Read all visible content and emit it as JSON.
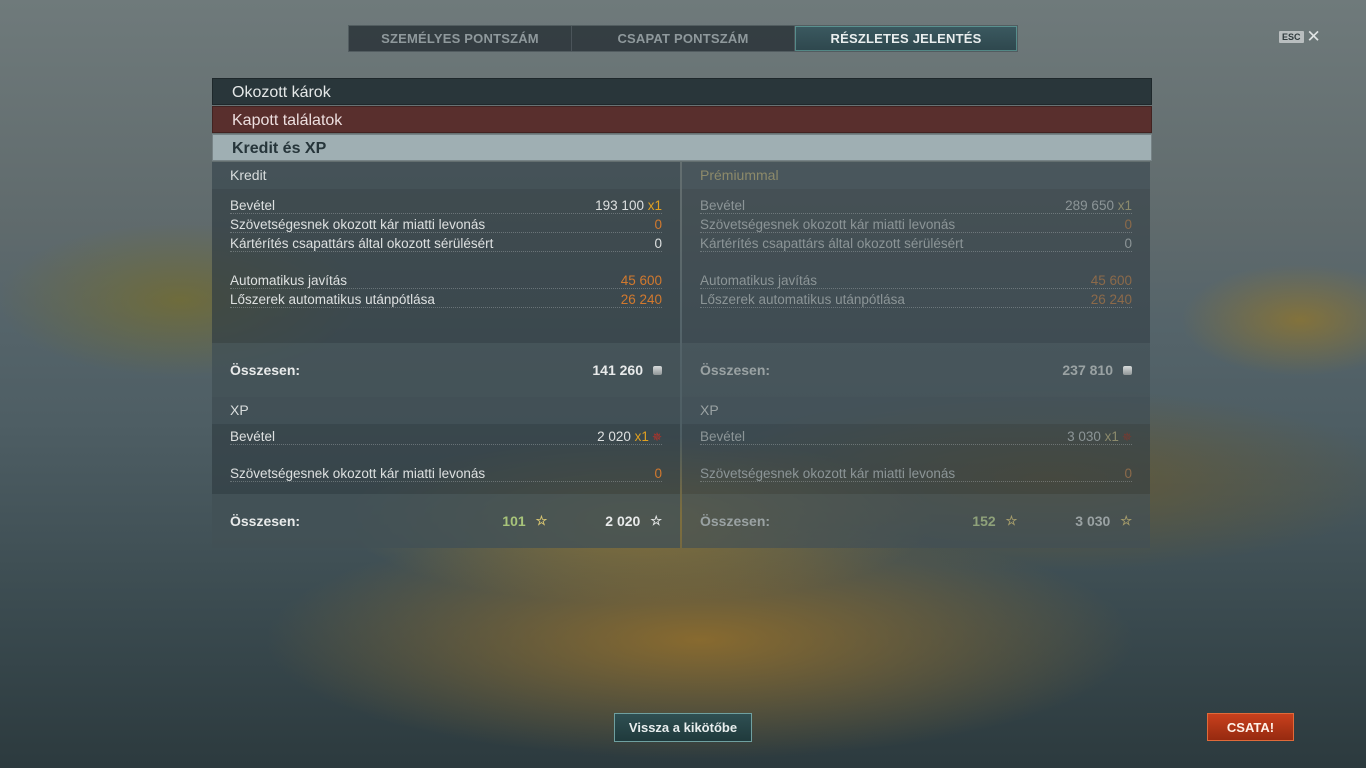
{
  "tabs": [
    "SZEMÉLYES PONTSZÁM",
    "CSAPAT PONTSZÁM",
    "RÉSZLETES JELENTÉS"
  ],
  "active_tab": "RÉSZLETES JELENTÉS",
  "esc_label": "ESC",
  "close_glyph": "✕",
  "sections": {
    "damage": "Okozott károk",
    "hits": "Kapott találatok",
    "credit_xp": "Kredit és XP"
  },
  "credit": {
    "header": "Kredit",
    "premium_header": "Prémiummal",
    "rows": [
      {
        "label": "Bevétel",
        "value": "193 100",
        "mult": "x1",
        "premium_value": "289 650",
        "premium_mult": "x1"
      },
      {
        "label": "Szövetségesnek okozott kár miatti levonás",
        "value": "0",
        "premium_value": "0"
      },
      {
        "label": "Kártérítés csapattárs által okozott sérülésért",
        "value": "0",
        "premium_value": "0"
      },
      {
        "label": "Automatikus javítás",
        "value": "45 600",
        "premium_value": "45 600"
      },
      {
        "label": "Lőszerek automatikus utánpótlása",
        "value": "26 240",
        "premium_value": "26 240"
      }
    ],
    "total_label": "Összesen:",
    "total": "141 260",
    "premium_total": "237 810"
  },
  "xp": {
    "header": "XP",
    "premium_header": "XP",
    "rows": [
      {
        "label": "Bevétel",
        "value": "2 020",
        "mult": "x1",
        "premium_value": "3 030",
        "premium_mult": "x1"
      },
      {
        "label": "Szövetségesnek okozott kár miatti levonás",
        "value": "0",
        "premium_value": "0"
      }
    ],
    "total_label": "Összesen:",
    "total_green": "101",
    "total": "2 020",
    "premium_total_green": "152",
    "premium_total": "3 030"
  },
  "buttons": {
    "back_to_port": "Vissza a kikötőbe",
    "battle": "CSATA!"
  },
  "icons": {
    "coin": "credit-coin-icon",
    "star": "☆",
    "flag": "✵"
  },
  "colors": {
    "orange": "#d2792e",
    "green_xp": "#a8c47a",
    "battle_button": "#c8401d",
    "active_tab": "#3b5960"
  }
}
